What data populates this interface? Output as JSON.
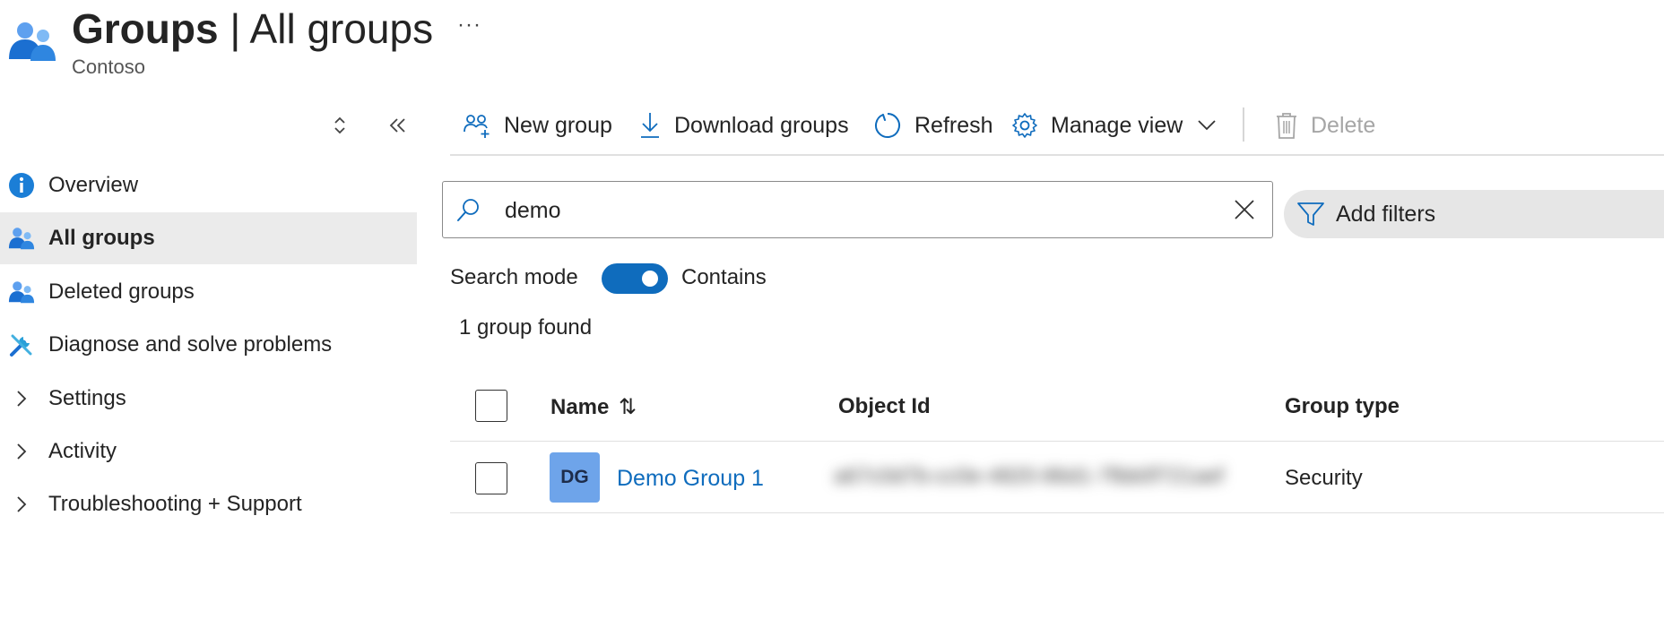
{
  "header": {
    "title_main": "Groups",
    "title_separator": "|",
    "title_sub": "All groups",
    "tenant": "Contoso",
    "more_label": "···"
  },
  "nav": {
    "items": [
      {
        "label": "Overview",
        "icon": "info-icon"
      },
      {
        "label": "All groups",
        "icon": "groups-icon",
        "active": true
      },
      {
        "label": "Deleted groups",
        "icon": "groups-icon"
      },
      {
        "label": "Diagnose and solve problems",
        "icon": "wrench-icon"
      },
      {
        "label": "Settings",
        "icon": "chevron-right-icon"
      },
      {
        "label": "Activity",
        "icon": "chevron-right-icon"
      },
      {
        "label": "Troubleshooting + Support",
        "icon": "chevron-right-icon"
      }
    ],
    "expand_icon": "sort-expand-icon",
    "collapse_icon": "double-chevron-left-icon",
    "collapse_label": "«"
  },
  "toolbar": {
    "new_group": "New group",
    "download_groups": "Download groups",
    "refresh": "Refresh",
    "manage_view": "Manage view",
    "delete": "Delete"
  },
  "search": {
    "value": "demo",
    "placeholder": "Search",
    "add_filter": "Add filters"
  },
  "search_mode": {
    "label": "Search mode",
    "toggle_on": true,
    "toggle_label": "Contains"
  },
  "results": {
    "count_text": "1 group found"
  },
  "table": {
    "columns": {
      "name": "Name",
      "sort_glyph": "⇅",
      "object_id": "Object Id",
      "group_type": "Group type"
    },
    "rows": [
      {
        "initials": "DG",
        "name": "Demo Group 1",
        "object_id": "a67c0d7b-cc0e-4820-86d1-7fbb0f721aef",
        "group_type": "Security"
      }
    ]
  },
  "colors": {
    "accent": "#0f6cbd",
    "avatar_bg": "#6ea4ea",
    "nav_active_bg": "#ebebeb",
    "disabled_text": "#a6a6a6"
  }
}
